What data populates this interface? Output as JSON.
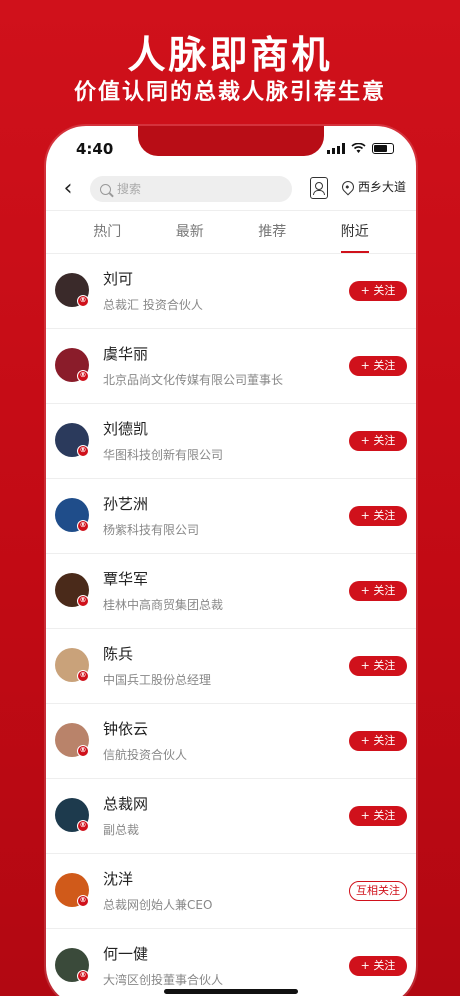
{
  "hero": {
    "title": "人脉即商机",
    "subtitle": "价值认同的总裁人脉引荐生意"
  },
  "status_bar": {
    "time": "4:40"
  },
  "navbar": {
    "back": "‹",
    "search_placeholder": "搜索",
    "location": "西乡大道"
  },
  "tabs": [
    "热门",
    "最新",
    "推荐",
    "附近"
  ],
  "active_tab": "附近",
  "brand_color": "#d0111b",
  "people": [
    {
      "name": "刘可",
      "desc": "总裁汇 投资合伙人",
      "action": "+ 关注",
      "avatar_color": "#3a2a2a"
    },
    {
      "name": "虞华丽",
      "desc": "北京品尚文化传媒有限公司董事长",
      "action": "+ 关注",
      "avatar_color": "#8a1c2a"
    },
    {
      "name": "刘德凯",
      "desc": "华图科技创新有限公司",
      "action": "+ 关注",
      "avatar_color": "#2b3a5c"
    },
    {
      "name": "孙艺洲",
      "desc": "杨紫科技有限公司",
      "action": "+ 关注",
      "avatar_color": "#1f4d8a"
    },
    {
      "name": "覃华军",
      "desc": "桂林中高商贸集团总裁",
      "action": "+ 关注",
      "avatar_color": "#4a2a1a"
    },
    {
      "name": "陈兵",
      "desc": "中国兵工股份总经理",
      "action": "+ 关注",
      "avatar_color": "#c9a27a"
    },
    {
      "name": "钟依云",
      "desc": "信航投资合伙人",
      "action": "+ 关注",
      "avatar_color": "#b9836a"
    },
    {
      "name": "总裁网",
      "desc": "副总裁",
      "action": "+ 关注",
      "avatar_color": "#1d3a4d"
    },
    {
      "name": "沈洋",
      "desc": "总裁网创始人兼CEO",
      "action": "互相关注",
      "avatar_color": "#d05a1a"
    },
    {
      "name": "何一健",
      "desc": "大湾区创投董事合伙人",
      "action": "+ 关注",
      "avatar_color": "#3a4a3a"
    }
  ]
}
